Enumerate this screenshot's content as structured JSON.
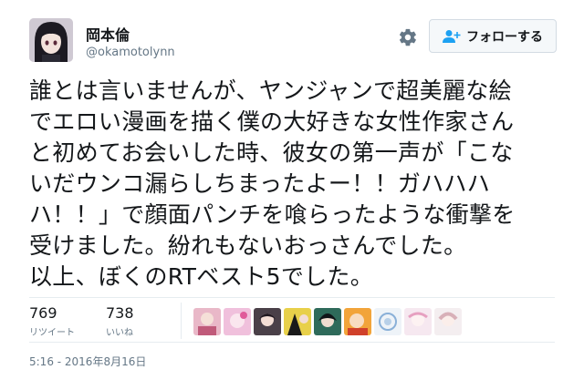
{
  "user": {
    "display_name": "岡本倫",
    "screen_name": "@okamotolynn",
    "avatar_icon": "user-avatar"
  },
  "actions": {
    "follow_label": "フォローする",
    "follow_icon": "add-user-icon",
    "settings_icon": "gear-icon"
  },
  "tweet": {
    "text": "誰とは言いませんが、ヤンジャンで超美麗な絵\nでエロい漫画を描く僕の大好きな女性作家さん\nと初めてお会いした時、彼女の第一声が「こな\nいだウンコ漏らしちまったよー！！ガハハハ\nハ！！」で顔面パンチを喰らったような衝撃を\n受けました。紛れもないおっさんでした。\n以上、ぼくのRTベスト5でした。"
  },
  "stats": {
    "retweets_count": "769",
    "retweets_label": "リツイート",
    "likes_count": "738",
    "likes_label": "いいね"
  },
  "likers_count_shown": 9,
  "timestamp": "5:16 - 2016年8月16日",
  "colors": {
    "text": "#14171a",
    "secondary": "#657786",
    "divider": "#e6ecf0",
    "follow_icon": "#1da1f2"
  }
}
